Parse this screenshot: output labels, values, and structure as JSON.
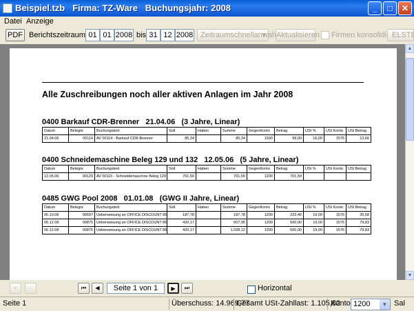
{
  "window": {
    "title": "Beispiel.tzb   Firma: TZ-Ware   Buchungsjahr: 2008",
    "minimize": "_",
    "maximize": "□",
    "close": "✕"
  },
  "menu": [
    "Datei",
    "Anzeige"
  ],
  "toolbar": {
    "pdf": "PDF",
    "range_label": "Berichtszeitraum vom",
    "from_day": "01",
    "from_month": "01",
    "from_year": "2008",
    "to_label": "bis",
    "to_day": "31",
    "to_month": "12",
    "to_year": "2008",
    "quick_select": "Zeitraumschnellanwahl",
    "refresh": "Aktualisieren",
    "consolidate": "Firmen konsolidieren",
    "elster": "ELSTE"
  },
  "report": {
    "title": "Alle Zuschreibungen noch aller aktiven Anlagen im Jahr 2008",
    "columns": [
      "Datum",
      "Belegnr.",
      "Buchungstext",
      "Soll",
      "Haben",
      "Summe",
      "GegenKonto",
      "Betrag",
      "USt %",
      "USt Konto",
      "USt Betrag"
    ],
    "sections": [
      {
        "title": "0400 Barkauf CDR-Brenner   21.04.06   (3 Jahre, Linear)",
        "rows": [
          [
            "21.04.06",
            "00114",
            "AV 00114 - Barkauf CDR-Brenner",
            "85,34",
            "",
            "85,34",
            "1590",
            "99,00",
            "16,00",
            "1576",
            "13,66"
          ]
        ]
      },
      {
        "title": "0400 Schneidemaschine Beleg 129 und 132   12.05.06   (5 Jahre, Linear)",
        "rows": [
          [
            "12.05.06",
            "00129",
            "AV 00115 - Schneidemaschine Beleg 129",
            "701,59",
            "",
            "701,59",
            "1200",
            "701,59",
            "",
            "",
            ""
          ]
        ]
      },
      {
        "title": "0485 GWG Pool 2008   01.01.08   (GWG II Jahre, Linear)",
        "rows": [
          [
            "06.10.08",
            "00697",
            "Ueberweisung an OFFICE DISCOUNT 85",
            "187,78",
            "",
            "187,78",
            "1200",
            "223,46",
            "19,00",
            "1576",
            "35,68"
          ],
          [
            "06.12.08",
            "00875",
            "Ueberweisung an OFFICE DISCOUNT 85",
            "420,17",
            "",
            "607,95",
            "1200",
            "500,00",
            "19,00",
            "1576",
            "79,83"
          ],
          [
            "06.12.08",
            "00875",
            "Ueberweisung an OFFICE DISCOUNT 85",
            "420,17",
            "",
            "1.028,12",
            "1200",
            "500,00",
            "19,00",
            "1576",
            "79,83"
          ]
        ]
      }
    ]
  },
  "nav": {
    "zoom_in": "+",
    "zoom_out": "-",
    "first": "⏮",
    "prev": "◀",
    "page": "Seite 1 von 1",
    "next": "▶",
    "last": "⏭",
    "horizontal": "Horizontal"
  },
  "status": {
    "page": "Seite 1",
    "surplus": "Überschuss: 14.969,77",
    "vat": "Gesamt USt-Zahllast: 1.105,82",
    "account_label": "Konto:",
    "account_value": "1200",
    "extra": "Sal"
  }
}
